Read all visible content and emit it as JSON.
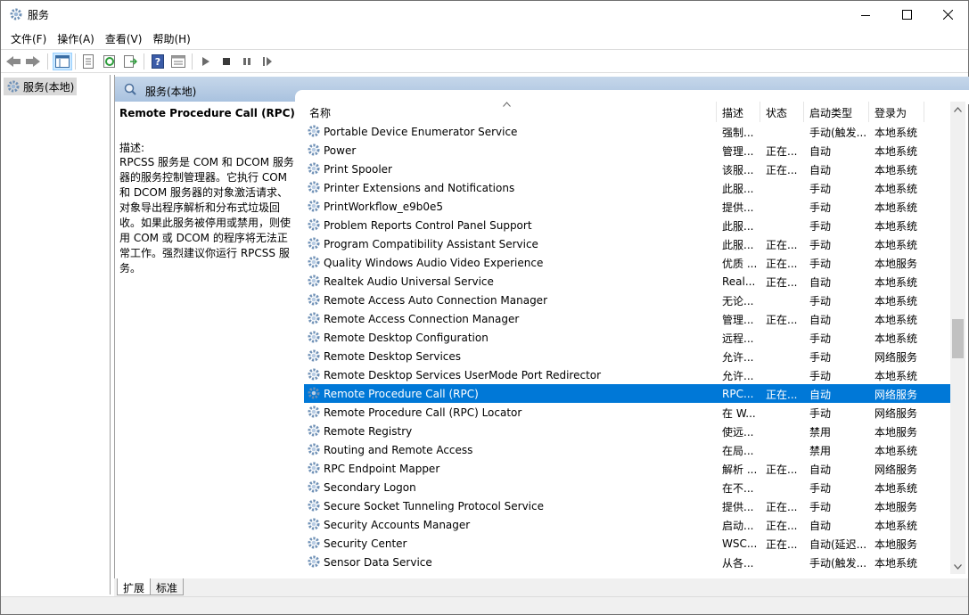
{
  "window": {
    "title": "服务",
    "icon": "services-gear-icon"
  },
  "menu": [
    "文件(F)",
    "操作(A)",
    "查看(V)",
    "帮助(H)"
  ],
  "tree": {
    "item_label": "服务(本地)"
  },
  "pane_header": {
    "title": "服务(本地)"
  },
  "description": {
    "service_name": "Remote Procedure Call (RPC)",
    "label": "描述:",
    "body": "RPCSS 服务是 COM 和 DCOM 服务器的服务控制管理器。它执行 COM 和 DCOM 服务器的对象激活请求、对象导出程序解析和分布式垃圾回收。如果此服务被停用或禁用，则使用 COM 或 DCOM 的程序将无法正常工作。强烈建议你运行 RPCSS 服务。"
  },
  "columns": {
    "name": "名称",
    "desc": "描述",
    "status": "状态",
    "startup": "启动类型",
    "logon": "登录为"
  },
  "services": [
    {
      "name": "Portable Device Enumerator Service",
      "desc": "强制...",
      "status": "",
      "startup": "手动(触发...",
      "logon": "本地系统",
      "selected": false
    },
    {
      "name": "Power",
      "desc": "管理...",
      "status": "正在...",
      "startup": "自动",
      "logon": "本地系统",
      "selected": false
    },
    {
      "name": "Print Spooler",
      "desc": "该服...",
      "status": "正在...",
      "startup": "自动",
      "logon": "本地系统",
      "selected": false
    },
    {
      "name": "Printer Extensions and Notifications",
      "desc": "此服...",
      "status": "",
      "startup": "手动",
      "logon": "本地系统",
      "selected": false
    },
    {
      "name": "PrintWorkflow_e9b0e5",
      "desc": "提供...",
      "status": "",
      "startup": "手动",
      "logon": "本地系统",
      "selected": false
    },
    {
      "name": "Problem Reports Control Panel Support",
      "desc": "此服...",
      "status": "",
      "startup": "手动",
      "logon": "本地系统",
      "selected": false
    },
    {
      "name": "Program Compatibility Assistant Service",
      "desc": "此服...",
      "status": "正在...",
      "startup": "手动",
      "logon": "本地系统",
      "selected": false
    },
    {
      "name": "Quality Windows Audio Video Experience",
      "desc": "优质 ...",
      "status": "正在...",
      "startup": "手动",
      "logon": "本地服务",
      "selected": false
    },
    {
      "name": "Realtek Audio Universal Service",
      "desc": "Real...",
      "status": "正在...",
      "startup": "自动",
      "logon": "本地系统",
      "selected": false
    },
    {
      "name": "Remote Access Auto Connection Manager",
      "desc": "无论...",
      "status": "",
      "startup": "手动",
      "logon": "本地系统",
      "selected": false
    },
    {
      "name": "Remote Access Connection Manager",
      "desc": "管理...",
      "status": "正在...",
      "startup": "自动",
      "logon": "本地系统",
      "selected": false
    },
    {
      "name": "Remote Desktop Configuration",
      "desc": "远程...",
      "status": "",
      "startup": "手动",
      "logon": "本地系统",
      "selected": false
    },
    {
      "name": "Remote Desktop Services",
      "desc": "允许...",
      "status": "",
      "startup": "手动",
      "logon": "网络服务",
      "selected": false
    },
    {
      "name": "Remote Desktop Services UserMode Port Redirector",
      "desc": "允许...",
      "status": "",
      "startup": "手动",
      "logon": "本地系统",
      "selected": false
    },
    {
      "name": "Remote Procedure Call (RPC)",
      "desc": "RPC...",
      "status": "正在...",
      "startup": "自动",
      "logon": "网络服务",
      "selected": true
    },
    {
      "name": "Remote Procedure Call (RPC) Locator",
      "desc": "在 W...",
      "status": "",
      "startup": "手动",
      "logon": "网络服务",
      "selected": false
    },
    {
      "name": "Remote Registry",
      "desc": "使远...",
      "status": "",
      "startup": "禁用",
      "logon": "本地服务",
      "selected": false
    },
    {
      "name": "Routing and Remote Access",
      "desc": "在局...",
      "status": "",
      "startup": "禁用",
      "logon": "本地系统",
      "selected": false
    },
    {
      "name": "RPC Endpoint Mapper",
      "desc": "解析 ...",
      "status": "正在...",
      "startup": "自动",
      "logon": "网络服务",
      "selected": false
    },
    {
      "name": "Secondary Logon",
      "desc": "在不...",
      "status": "",
      "startup": "手动",
      "logon": "本地系统",
      "selected": false
    },
    {
      "name": "Secure Socket Tunneling Protocol Service",
      "desc": "提供...",
      "status": "正在...",
      "startup": "手动",
      "logon": "本地服务",
      "selected": false
    },
    {
      "name": "Security Accounts Manager",
      "desc": "启动...",
      "status": "正在...",
      "startup": "自动",
      "logon": "本地系统",
      "selected": false
    },
    {
      "name": "Security Center",
      "desc": "WSC...",
      "status": "正在...",
      "startup": "自动(延迟...",
      "logon": "本地服务",
      "selected": false
    },
    {
      "name": "Sensor Data Service",
      "desc": "从各...",
      "status": "",
      "startup": "手动(触发...",
      "logon": "本地系统",
      "selected": false
    }
  ],
  "tabs": [
    "扩展",
    "标准"
  ],
  "colors": {
    "selected_row": "#0078d7",
    "pane_header": "#b8cde6"
  }
}
